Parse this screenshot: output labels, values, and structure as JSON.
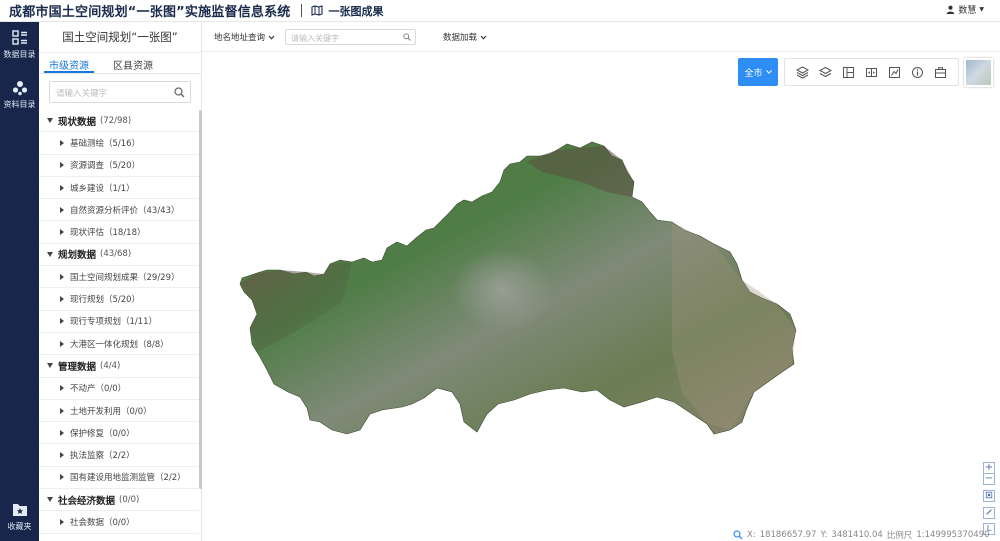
{
  "header": {
    "app_title": "成都市国土空间规划“一张图”实施监督信息系统",
    "sub_title": "一张图成果",
    "user_name": "数慧"
  },
  "rail": {
    "items": [
      {
        "label": "数据目录",
        "icon": "catalog-icon"
      },
      {
        "label": "资料目录",
        "icon": "materials-icon"
      },
      {
        "label": "收藏夹",
        "icon": "favorites-icon"
      }
    ]
  },
  "panel": {
    "title": "国土空间规划“一张图”",
    "tabs": [
      "市级资源",
      "区县资源"
    ],
    "active_tab": "市级资源",
    "search_placeholder": "请输入关键字",
    "tree": [
      {
        "type": "cat",
        "name": "现状数据",
        "count": "(72/98)"
      },
      {
        "type": "sub",
        "name": "基础测绘（5/16）"
      },
      {
        "type": "sub",
        "name": "资源调查（5/20）"
      },
      {
        "type": "sub",
        "name": "城乡建设（1/1）"
      },
      {
        "type": "sub",
        "name": "自然资源分析评价（43/43）"
      },
      {
        "type": "sub",
        "name": "现状评估（18/18）"
      },
      {
        "type": "cat",
        "name": "规划数据",
        "count": "(43/68)"
      },
      {
        "type": "sub",
        "name": "国土空间规划成果（29/29）"
      },
      {
        "type": "sub",
        "name": "现行规划（5/20）"
      },
      {
        "type": "sub",
        "name": "现行专项规划（1/11）"
      },
      {
        "type": "sub",
        "name": "大港区一体化规划（8/8）"
      },
      {
        "type": "cat",
        "name": "管理数据",
        "count": "(4/4)"
      },
      {
        "type": "sub",
        "name": "不动产（0/0）"
      },
      {
        "type": "sub",
        "name": "土地开发利用（0/0）"
      },
      {
        "type": "sub",
        "name": "保护修复（0/0）"
      },
      {
        "type": "sub",
        "name": "执法监察（2/2）"
      },
      {
        "type": "sub",
        "name": "国有建设用地监测监管（2/2）"
      },
      {
        "type": "cat",
        "name": "社会经济数据",
        "count": "(0/0)"
      },
      {
        "type": "sub",
        "name": "社会数据（0/0）"
      }
    ]
  },
  "toolbar": {
    "place_query_label": "地名地址查询",
    "search_placeholder": "请输入关键字",
    "data_load_label": "数据加载"
  },
  "map": {
    "region_label": "全市",
    "tool_icons": [
      "layers-icon",
      "layer-stack-icon",
      "split-screen-icon",
      "compare-icon",
      "chart-icon",
      "info-icon",
      "toolbox-icon"
    ],
    "coords": {
      "x_label": "X:",
      "x": "18186657.97",
      "y_label": "Y:",
      "y": "3481410.04",
      "scale_label": "比例尺",
      "scale": "1:149995370490"
    },
    "zoom_in": "+",
    "zoom_out": "−",
    "legend_label": "L"
  },
  "colors": {
    "rail_bg": "#17264a",
    "accent": "#1677d9",
    "region_button": "#2f8ef5"
  }
}
